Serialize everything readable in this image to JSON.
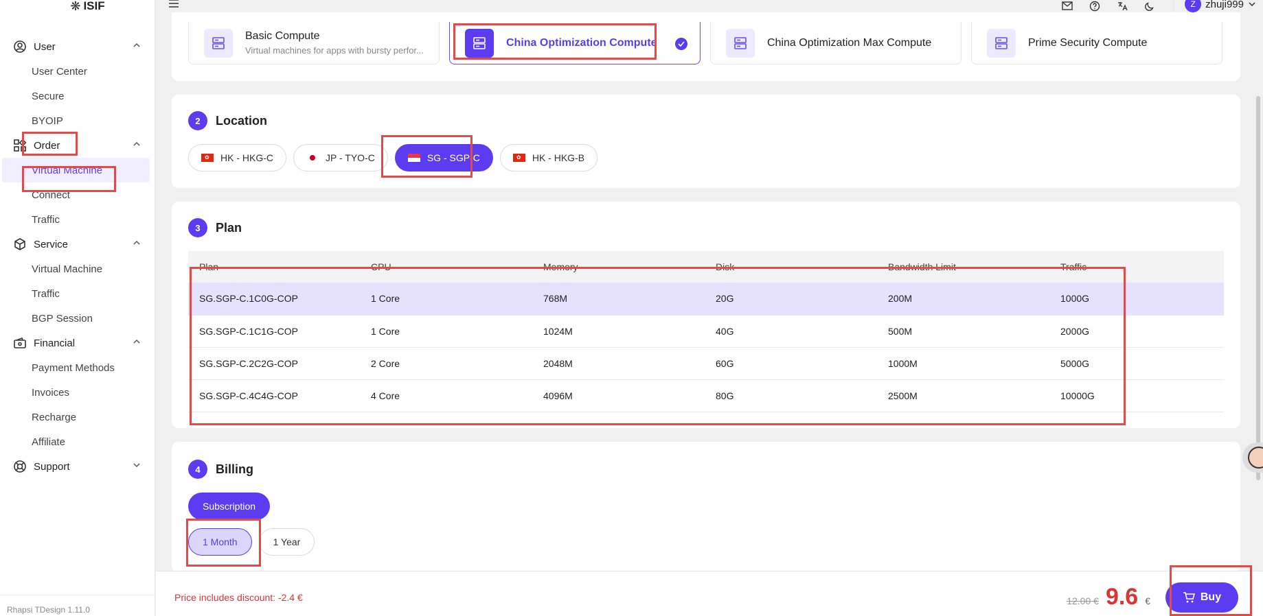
{
  "app": {
    "logo_text": "ISIF",
    "version": "Rhapsi TDesign 1.11.0"
  },
  "topbar": {
    "username": "zhuji999",
    "avatar_letter": "Z"
  },
  "sidebar": {
    "groups": [
      {
        "label": "User",
        "items": [
          "User Center",
          "Secure",
          "BYOIP"
        ]
      },
      {
        "label": "Order",
        "items": [
          "Virtual Machine",
          "Connect",
          "Traffic"
        ]
      },
      {
        "label": "Service",
        "items": [
          "Virtual Machine",
          "Traffic",
          "BGP Session"
        ]
      },
      {
        "label": "Financial",
        "items": [
          "Payment Methods",
          "Invoices",
          "Recharge",
          "Affiliate"
        ]
      },
      {
        "label": "Support",
        "items": []
      }
    ]
  },
  "compute_types": [
    {
      "name": "Basic Compute",
      "desc": "Virtual machines for apps with bursty perfor..."
    },
    {
      "name": "China Optimization Compute",
      "desc": ""
    },
    {
      "name": "China Optimization Max Compute",
      "desc": ""
    },
    {
      "name": "Prime Security Compute",
      "desc": ""
    }
  ],
  "location": {
    "step": "2",
    "title": "Location",
    "options": [
      "HK - HKG-C",
      "JP - TYO-C",
      "SG - SGP-C",
      "HK - HKG-B"
    ],
    "selected": "SG - SGP-C"
  },
  "plan": {
    "step": "3",
    "title": "Plan",
    "headers": [
      "Plan",
      "CPU",
      "Memory",
      "Disk",
      "Bandwidth Limit",
      "Traffic"
    ],
    "rows": [
      [
        "SG.SGP-C.1C0G-COP",
        "1 Core",
        "768M",
        "20G",
        "200M",
        "1000G"
      ],
      [
        "SG.SGP-C.1C1G-COP",
        "1 Core",
        "1024M",
        "40G",
        "500M",
        "2000G"
      ],
      [
        "SG.SGP-C.2C2G-COP",
        "2 Core",
        "2048M",
        "60G",
        "1000M",
        "5000G"
      ],
      [
        "SG.SGP-C.4C4G-COP",
        "4 Core",
        "4096M",
        "80G",
        "2500M",
        "10000G"
      ]
    ]
  },
  "billing": {
    "step": "4",
    "title": "Billing",
    "type": "Subscription",
    "periods": [
      "1 Month",
      "1 Year"
    ],
    "selected": "1 Month"
  },
  "footer": {
    "discount_text": "Price includes discount: -2.4 €",
    "old_price": "12.00 €",
    "new_price": "9.6",
    "currency": "€",
    "buy_label": "Buy"
  },
  "colors": {
    "accent": "#5b3cf0",
    "price": "#dd3333",
    "annotation": "#e54848"
  }
}
